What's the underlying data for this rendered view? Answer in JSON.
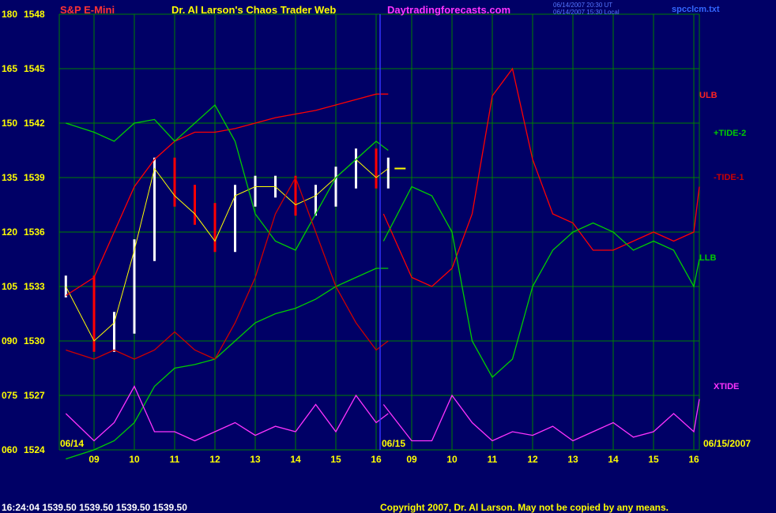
{
  "header": {
    "symbol": "S&P E-Mini",
    "title": "Dr. Al Larson's Chaos Trader Web",
    "site": "Daytradingforecasts.com",
    "stamp_line1": "06/14/2007 20:30 UT",
    "stamp_line2": "06/14/2007 15:30 Local",
    "filename": "spcclcm.txt"
  },
  "footer": {
    "status": "16:24:04  1539.50  1539.50  1539.50  1539.50",
    "copyright": "Copyright 2007, Dr. Al Larson. May not be copied by any means."
  },
  "colors": {
    "background": "#000066",
    "grid": "#008000",
    "price_bar": "#ffffff",
    "price_bar_down": "#ff0000",
    "ulb": "#ff0000",
    "llb": "#00cc00",
    "tide2": "#00cc00",
    "tide1": "#cc0000",
    "xtide": "#ff33ff",
    "ma_fast": "#ffff00",
    "ma_slow": "#3344ff",
    "today_divider": "#3333ff",
    "axis_text": "#ffff00"
  },
  "chart_data": {
    "type": "line",
    "title": "S&P E-Mini",
    "y_left_ticks": [
      "180",
      "165",
      "150",
      "135",
      "120",
      "105",
      "090",
      "075",
      "060"
    ],
    "y_price_ticks": [
      "1548",
      "1545",
      "1542",
      "1539",
      "1536",
      "1533",
      "1530",
      "1527",
      "1524"
    ],
    "ylim_price": [
      1524,
      1548
    ],
    "ylim_index": [
      60,
      180
    ],
    "x_ticks": [
      "09",
      "10",
      "11",
      "12",
      "13",
      "14",
      "15",
      "16",
      "09",
      "10",
      "11",
      "12",
      "13",
      "14",
      "15",
      "16"
    ],
    "date_labels": [
      "06/14",
      "06/15",
      "06/15/2007"
    ],
    "series_labels": [
      {
        "name": "ULB",
        "color": "#ff0000"
      },
      {
        "name": "+TIDE-2",
        "color": "#00cc00"
      },
      {
        "name": "-TIDE-1",
        "color": "#cc0000"
      },
      {
        "name": "LLB",
        "color": "#00cc00"
      },
      {
        "name": "XTIDE",
        "color": "#ff33ff"
      }
    ],
    "x_hours": [
      8.3,
      9.0,
      9.5,
      10.0,
      10.5,
      11.0,
      11.5,
      12.0,
      12.5,
      13.0,
      13.5,
      14.0,
      14.5,
      15.0,
      15.5,
      16.0,
      16.3
    ],
    "series": [
      {
        "name": "price_close",
        "day": 1,
        "values": [
          1533.0,
          1530.0,
          1531.0,
          1535.0,
          1539.5,
          1538.0,
          1537.0,
          1535.5,
          1538.0,
          1538.5,
          1538.5,
          1537.5,
          1538.0,
          1539.0,
          1540.0,
          1539.0,
          1539.5
        ]
      },
      {
        "name": "ULB",
        "day": 1,
        "values": [
          1532.5,
          1533.5,
          1536.0,
          1538.5,
          1540.0,
          1541.0,
          1541.5,
          1541.5,
          1541.7,
          1542.0,
          1542.3,
          1542.5,
          1542.7,
          1543.0,
          1543.3,
          1543.6,
          1543.6
        ]
      },
      {
        "name": "LLB",
        "day": 1,
        "values": [
          1523.5,
          1524.0,
          1524.5,
          1525.5,
          1527.5,
          1528.5,
          1528.7,
          1529.0,
          1530.0,
          1531.0,
          1531.5,
          1531.8,
          1532.3,
          1533.0,
          1533.5,
          1534.0,
          1534.0
        ]
      },
      {
        "name": "+TIDE-2",
        "day": 1,
        "values": [
          1542.0,
          1541.5,
          1541.0,
          1542.0,
          1542.2,
          1541.0,
          1542.0,
          1543.0,
          1541.0,
          1537.0,
          1535.5,
          1535.0,
          1537.0,
          1539.0,
          1540.0,
          1541.0,
          1540.5
        ]
      },
      {
        "name": "-TIDE-1",
        "day": 1,
        "values": [
          1529.5,
          1529.0,
          1529.5,
          1529.0,
          1529.5,
          1530.5,
          1529.5,
          1529.0,
          1531.0,
          1533.5,
          1537.0,
          1539.0,
          1536.0,
          1533.0,
          1531.0,
          1529.5,
          1530.0
        ]
      },
      {
        "name": "ULB",
        "day": 2,
        "values": [
          1537.0,
          1533.5,
          1533.0,
          1534.0,
          1537.0,
          1543.5,
          1545.0,
          1540.0,
          1537.0,
          1536.5,
          1535.0,
          1535.0,
          1535.5,
          1536.0,
          1535.5,
          1536.0,
          1538.5
        ]
      },
      {
        "name": "LLB",
        "day": 2,
        "values": [
          1535.5,
          1538.5,
          1538.0,
          1536.0,
          1530.0,
          1528.0,
          1529.0,
          1533.0,
          1535.0,
          1536.0,
          1536.5,
          1536.0,
          1535.0,
          1535.5,
          1535.0,
          1533.0,
          1534.5
        ]
      },
      {
        "name": "XTIDE",
        "day": 1,
        "values": [
          1526.0,
          1524.5,
          1525.5,
          1527.5,
          1525.0,
          1525.0,
          1524.5,
          1525.0,
          1525.5,
          1524.8,
          1525.3,
          1525.0,
          1526.5,
          1525.0,
          1527.0,
          1525.5,
          1526.0
        ]
      },
      {
        "name": "XTIDE",
        "day": 2,
        "values": [
          1526.5,
          1524.5,
          1524.5,
          1527.0,
          1525.5,
          1524.5,
          1525.0,
          1524.8,
          1525.3,
          1524.5,
          1525.0,
          1525.5,
          1524.7,
          1525.0,
          1526.0,
          1525.0,
          1526.8
        ]
      }
    ]
  }
}
